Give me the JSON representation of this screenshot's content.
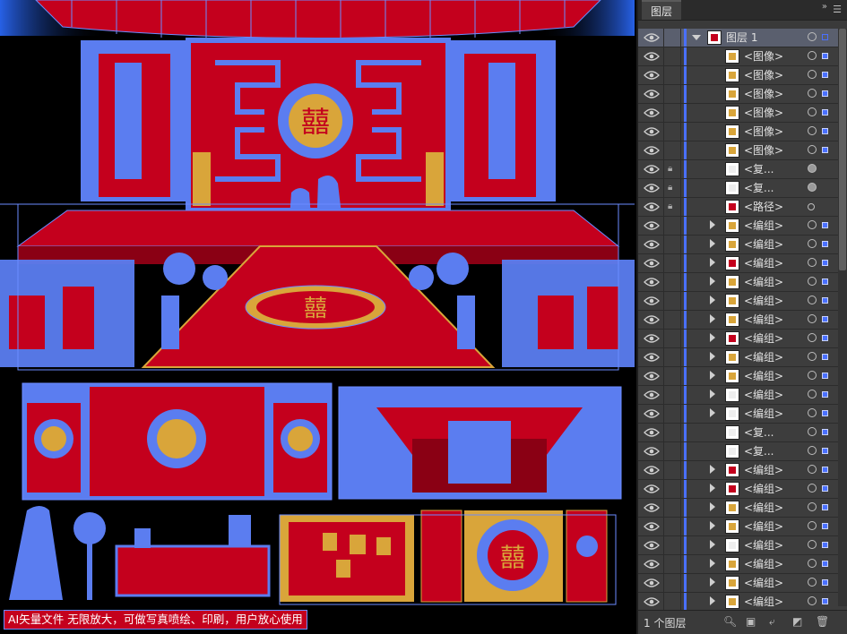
{
  "canvas": {
    "caption": "AI矢量文件 无限放大，可做写真喷绘、印刷，用户放心使用",
    "motif": "囍"
  },
  "panel": {
    "tab_label": "图层",
    "menu_icon": "panel-menu-icon",
    "collapse_icon": "collapse-arrows-icon",
    "footer": {
      "layer_count": "1 个图层",
      "icons": [
        "locate-object-icon",
        "make-clipping-mask-icon",
        "create-sublayer-icon",
        "create-new-layer-icon",
        "delete-icon"
      ]
    },
    "rows": [
      {
        "name": "图层 1",
        "top": true,
        "expand": "down",
        "lock": false,
        "thumb": "#c4001d",
        "target": "ring"
      },
      {
        "name": "<图像>",
        "lock": false,
        "expand": "",
        "thumb": "#d9a53a",
        "target": "ring"
      },
      {
        "name": "<图像>",
        "lock": false,
        "expand": "",
        "thumb": "#d9a53a",
        "target": "ring"
      },
      {
        "name": "<图像>",
        "lock": false,
        "expand": "",
        "thumb": "#d9a53a",
        "target": "ring"
      },
      {
        "name": "<图像>",
        "lock": false,
        "expand": "",
        "thumb": "#d9a53a",
        "target": "ring"
      },
      {
        "name": "<图像>",
        "lock": false,
        "expand": "",
        "thumb": "#d9a53a",
        "target": "ring"
      },
      {
        "name": "<图像>",
        "lock": false,
        "expand": "",
        "thumb": "#d9a53a",
        "target": "ring"
      },
      {
        "name": "<复...",
        "lock": true,
        "expand": "",
        "thumb": "#eeeeee",
        "target": "dot"
      },
      {
        "name": "<复...",
        "lock": true,
        "expand": "",
        "thumb": "#eeeeee",
        "target": "dot"
      },
      {
        "name": "<路径>",
        "lock": true,
        "expand": "",
        "thumb": "#c4001d",
        "target": "ring-small"
      },
      {
        "name": "<编组>",
        "lock": false,
        "expand": "right",
        "thumb": "#d9a53a",
        "target": "ring"
      },
      {
        "name": "<编组>",
        "lock": false,
        "expand": "right",
        "thumb": "#d9a53a",
        "target": "ring"
      },
      {
        "name": "<编组>",
        "lock": false,
        "expand": "right",
        "thumb": "#c4001d",
        "target": "ring"
      },
      {
        "name": "<编组>",
        "lock": false,
        "expand": "right",
        "thumb": "#d9a53a",
        "target": "ring"
      },
      {
        "name": "<编组>",
        "lock": false,
        "expand": "right",
        "thumb": "#d9a53a",
        "target": "ring"
      },
      {
        "name": "<编组>",
        "lock": false,
        "expand": "right",
        "thumb": "#d9a53a",
        "target": "ring"
      },
      {
        "name": "<编组>",
        "lock": false,
        "expand": "right",
        "thumb": "#c4001d",
        "target": "ring"
      },
      {
        "name": "<编组>",
        "lock": false,
        "expand": "right",
        "thumb": "#d9a53a",
        "target": "ring"
      },
      {
        "name": "<编组>",
        "lock": false,
        "expand": "right",
        "thumb": "#d9a53a",
        "target": "ring"
      },
      {
        "name": "<编组>",
        "lock": false,
        "expand": "right",
        "thumb": "#eeeeee",
        "target": "ring"
      },
      {
        "name": "<编组>",
        "lock": false,
        "expand": "right",
        "thumb": "#eeeeee",
        "target": "ring"
      },
      {
        "name": "<复...",
        "lock": false,
        "expand": "",
        "thumb": "#eeeeee",
        "target": "ring"
      },
      {
        "name": "<复...",
        "lock": false,
        "expand": "",
        "thumb": "#eeeeee",
        "target": "ring"
      },
      {
        "name": "<编组>",
        "lock": false,
        "expand": "right",
        "thumb": "#c4001d",
        "target": "ring"
      },
      {
        "name": "<编组>",
        "lock": false,
        "expand": "right",
        "thumb": "#c4001d",
        "target": "ring"
      },
      {
        "name": "<编组>",
        "lock": false,
        "expand": "right",
        "thumb": "#d9a53a",
        "target": "ring"
      },
      {
        "name": "<编组>",
        "lock": false,
        "expand": "right",
        "thumb": "#d9a53a",
        "target": "ring"
      },
      {
        "name": "<编组>",
        "lock": false,
        "expand": "right",
        "thumb": "#eeeeee",
        "target": "ring"
      },
      {
        "name": "<编组>",
        "lock": false,
        "expand": "right",
        "thumb": "#d9a53a",
        "target": "ring"
      },
      {
        "name": "<编组>",
        "lock": false,
        "expand": "right",
        "thumb": "#d9a53a",
        "target": "ring"
      },
      {
        "name": "<编组>",
        "lock": false,
        "expand": "right",
        "thumb": "#d9a53a",
        "target": "ring"
      }
    ]
  }
}
